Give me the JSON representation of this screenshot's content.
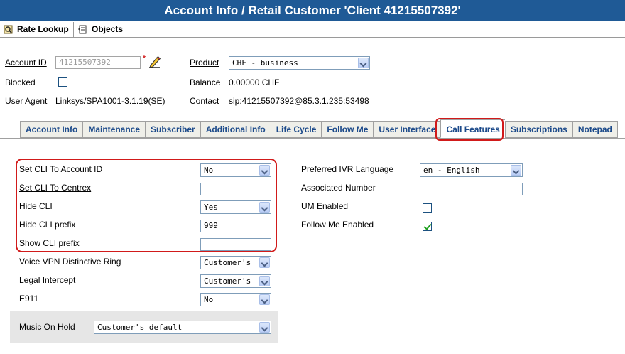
{
  "header": {
    "title": "Account Info / Retail Customer 'Client 41215507392'"
  },
  "toolbar": {
    "rate_lookup": "Rate Lookup",
    "objects": "Objects"
  },
  "account": {
    "account_id_label": "Account ID",
    "account_id_value": "41215507392",
    "required_marker": "*",
    "product_label": "Product",
    "product_value": "CHF - business",
    "blocked_label": "Blocked",
    "blocked_checked": false,
    "balance_label": "Balance",
    "balance_value": "0.00000 CHF",
    "user_agent_label": "User Agent",
    "user_agent_value": "Linksys/SPA1001-3.1.19(SE)",
    "contact_label": "Contact",
    "contact_value": "sip:41215507392@85.3.1.235:53498"
  },
  "tabs": [
    {
      "label": "Account Info",
      "active": false
    },
    {
      "label": "Maintenance",
      "active": false
    },
    {
      "label": "Subscriber",
      "active": false
    },
    {
      "label": "Additional Info",
      "active": false
    },
    {
      "label": "Life Cycle",
      "active": false
    },
    {
      "label": "Follow Me",
      "active": false
    },
    {
      "label": "User Interface",
      "active": false
    },
    {
      "label": "Call Features",
      "active": true
    },
    {
      "label": "Subscriptions",
      "active": false
    },
    {
      "label": "Notepad",
      "active": false
    }
  ],
  "call_features": {
    "set_cli_to_account_id": {
      "label": "Set CLI To Account ID",
      "value": "No"
    },
    "set_cli_to_centrex": {
      "label": "Set CLI To Centrex",
      "value": ""
    },
    "hide_cli": {
      "label": "Hide CLI",
      "value": "Yes"
    },
    "hide_cli_prefix": {
      "label": "Hide CLI prefix",
      "value": "999"
    },
    "show_cli_prefix": {
      "label": "Show CLI prefix",
      "value": ""
    },
    "voice_vpn_ring": {
      "label": "Voice VPN Distinctive Ring",
      "value": "Customer's"
    },
    "legal_intercept": {
      "label": "Legal Intercept",
      "value": "Customer's"
    },
    "e911": {
      "label": "E911",
      "value": "No"
    },
    "music_on_hold": {
      "label": "Music On Hold",
      "value": "Customer's default"
    },
    "preferred_ivr_language": {
      "label": "Preferred IVR Language",
      "value": "en - English"
    },
    "associated_number": {
      "label": "Associated Number",
      "value": ""
    },
    "um_enabled": {
      "label": "UM Enabled",
      "checked": false
    },
    "follow_me_enabled": {
      "label": "Follow Me Enabled",
      "checked": true
    }
  },
  "colors": {
    "header_bg": "#1f5a96",
    "tab_text": "#1c4a8a",
    "highlight": "#d11a1a"
  }
}
